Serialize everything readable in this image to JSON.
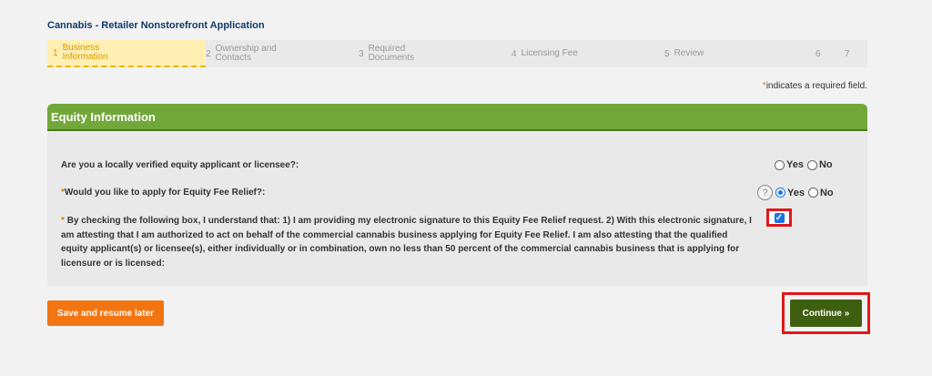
{
  "app": {
    "title": "Cannabis - Retailer Nonstorefront Application"
  },
  "steps": [
    {
      "num": "1",
      "label": "Business Information"
    },
    {
      "num": "2",
      "label": "Ownership and Contacts"
    },
    {
      "num": "3",
      "label": "Required Documents"
    },
    {
      "num": "4",
      "label": "Licensing Fee"
    },
    {
      "num": "5",
      "label": "Review"
    },
    {
      "num": "6",
      "label": ""
    },
    {
      "num": "7",
      "label": ""
    }
  ],
  "required_note": {
    "star": "*",
    "text": "indicates a required field."
  },
  "section": {
    "title": "Equity Information",
    "q1": {
      "text": "Are you a locally verified equity applicant or licensee?:",
      "yes": "Yes",
      "no": "No",
      "selected": "none"
    },
    "q2": {
      "star": "*",
      "text": "Would you like to apply for Equity Fee Relief?:",
      "yes": "Yes",
      "no": "No",
      "selected": "Yes",
      "help": "?"
    },
    "q3": {
      "star": "*",
      "text": "By checking the following box, I understand that: 1) I am providing my electronic signature to this Equity Fee Relief request. 2) With this electronic signature, I am attesting that I am authorized to act on behalf of the commercial cannabis business applying for Equity Fee Relief. I am also attesting that the qualified equity applicant(s) or licensee(s), either individually or in combination, own no less than 50 percent of the commercial cannabis business that is applying for licensure or is licensed:",
      "checked": true,
      "check_glyph": "✓"
    }
  },
  "buttons": {
    "save": "Save and resume later",
    "continue": "Continue »"
  },
  "colors": {
    "header_green": "#72a83a",
    "continue_green": "#3f5f10",
    "save_orange": "#f27512",
    "highlight_red": "#e01818"
  }
}
